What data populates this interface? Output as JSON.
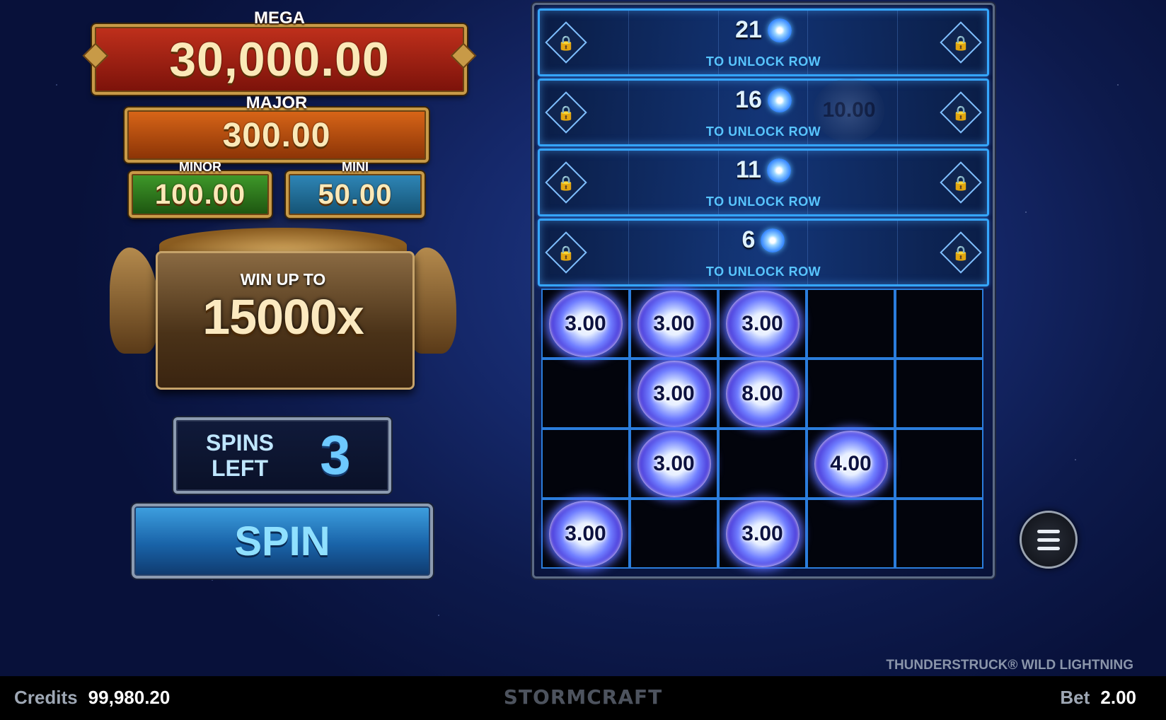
{
  "jackpots": {
    "mega": {
      "label": "MEGA",
      "value": "30,000.00"
    },
    "major": {
      "label": "MAJOR",
      "value": "300.00"
    },
    "minor": {
      "label": "MINOR",
      "value": "100.00"
    },
    "mini": {
      "label": "MINI",
      "value": "50.00"
    }
  },
  "feature": {
    "line1": "WIN UP TO",
    "line2": "15000x"
  },
  "spins": {
    "label": "SPINS LEFT",
    "count": "3"
  },
  "spin_button": {
    "label": "SPIN"
  },
  "locked_rows": [
    {
      "count": "21",
      "text": "TO UNLOCK ROW"
    },
    {
      "count": "16",
      "text": "TO UNLOCK ROW",
      "ghost_value": "10.00"
    },
    {
      "count": "11",
      "text": "TO UNLOCK ROW"
    },
    {
      "count": "6",
      "text": "TO UNLOCK ROW"
    }
  ],
  "grid": [
    [
      "3.00",
      "3.00",
      "3.00",
      "",
      ""
    ],
    [
      "",
      "3.00",
      "8.00",
      "",
      ""
    ],
    [
      "",
      "3.00",
      "",
      "4.00",
      ""
    ],
    [
      "3.00",
      "",
      "3.00",
      "",
      ""
    ]
  ],
  "game_title": "THUNDERSTRUCK® WILD LIGHTNING",
  "footer": {
    "credits_label": "Credits",
    "credits_value": "99,980.20",
    "brand": "STORMCRAFT",
    "bet_label": "Bet",
    "bet_value": "2.00"
  },
  "colors": {
    "accent_blue": "#35a7ff",
    "coin_glow": "#5a6cff"
  }
}
